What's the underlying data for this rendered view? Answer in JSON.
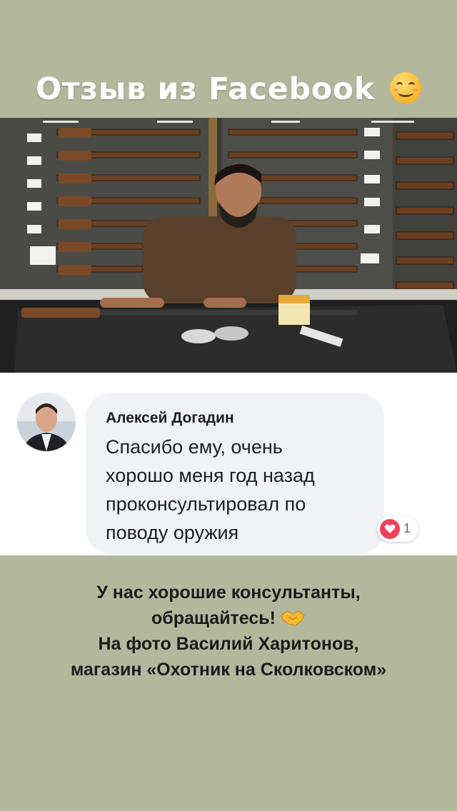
{
  "header": {
    "title": "Отзыв из Facebook",
    "title_emoji": "smiling-face-icon"
  },
  "photo": {
    "subject": "shop-photo"
  },
  "comment": {
    "author": "Алексей Догадин",
    "lines": [
      "Спасибо ему, очень",
      "хорошо меня год назад",
      "проконсультировал по",
      "поводу оружия"
    ],
    "reaction": {
      "icon": "heart-icon",
      "count": "1",
      "color": "#f0405b"
    }
  },
  "footer": {
    "lines": [
      "У нас хорошие консультанты,",
      "обращайтесь!",
      "На фото Василий Харитонов,",
      "магазин «Охотник на Сколковском»"
    ],
    "emoji": "handshake-icon"
  },
  "colors": {
    "background": "#b3b89d",
    "bubble": "#f0f2f5"
  }
}
